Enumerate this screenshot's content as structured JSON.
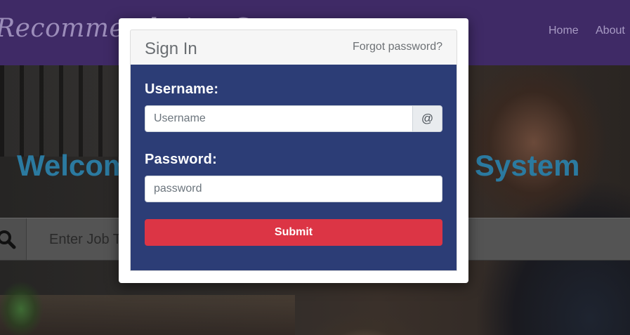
{
  "navbar": {
    "brand": "Recommendation System",
    "links": [
      {
        "label": "Home"
      },
      {
        "label": "About"
      }
    ]
  },
  "hero": {
    "title_left": "Welcome",
    "title_right": "System",
    "search_placeholder": "Enter Job Title"
  },
  "modal": {
    "title": "Sign In",
    "forgot_link": "Forgot password?",
    "username_label": "Username:",
    "username_placeholder": "Username",
    "username_addon": "@",
    "password_label": "Password:",
    "password_placeholder": "password",
    "submit_label": "Submit"
  },
  "colors": {
    "navbar_bg": "#3f2a66",
    "modal_body_bg": "#2c3d76",
    "submit_bg": "#dc3545",
    "hero_title": "#2b7aa0"
  },
  "icons": {
    "search": "search-icon"
  }
}
